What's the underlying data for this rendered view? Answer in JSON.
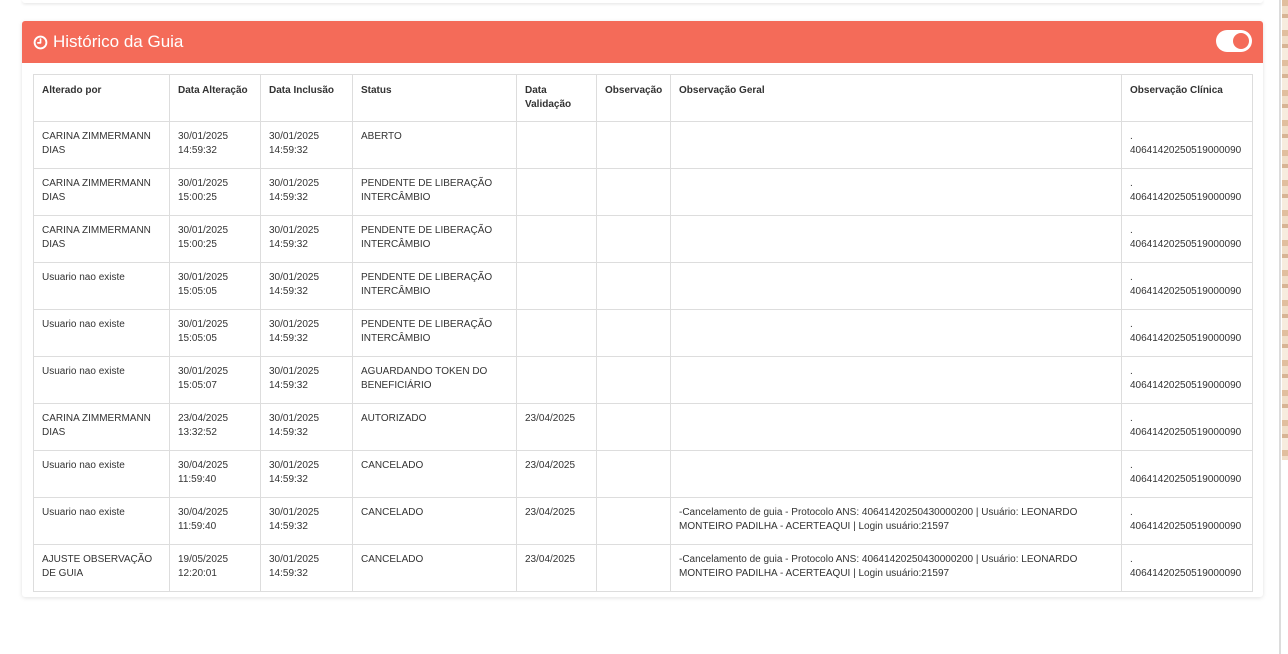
{
  "panel": {
    "title": "Histórico da Guia",
    "accent_color": "#f46b59",
    "title_icon": "clock-icon",
    "toggle_state": "on"
  },
  "table": {
    "headers": {
      "alterado_por": "Alterado por",
      "data_alteracao": "Data Alteração",
      "data_inclusao": "Data Inclusão",
      "status": "Status",
      "data_validacao": "Data Validação",
      "observacao": "Observação",
      "observacao_geral": "Observação Geral",
      "observacao_clinica": "Observação Clínica"
    },
    "rows": [
      {
        "alterado_por": "CARINA ZIMMERMANN DIAS",
        "data_alteracao": "30/01/2025 14:59:32",
        "data_inclusao": "30/01/2025 14:59:32",
        "status": "ABERTO",
        "data_validacao": "",
        "observacao": "",
        "observacao_geral": "",
        "observacao_clinica": ". 40641420250519000090"
      },
      {
        "alterado_por": "CARINA ZIMMERMANN DIAS",
        "data_alteracao": "30/01/2025 15:00:25",
        "data_inclusao": "30/01/2025 14:59:32",
        "status": "PENDENTE DE LIBERAÇÃO INTERCÂMBIO",
        "data_validacao": "",
        "observacao": "",
        "observacao_geral": "",
        "observacao_clinica": ". 40641420250519000090"
      },
      {
        "alterado_por": "CARINA ZIMMERMANN DIAS",
        "data_alteracao": "30/01/2025 15:00:25",
        "data_inclusao": "30/01/2025 14:59:32",
        "status": "PENDENTE DE LIBERAÇÃO INTERCÂMBIO",
        "data_validacao": "",
        "observacao": "",
        "observacao_geral": "",
        "observacao_clinica": ". 40641420250519000090"
      },
      {
        "alterado_por": "Usuario nao existe",
        "data_alteracao": "30/01/2025 15:05:05",
        "data_inclusao": "30/01/2025 14:59:32",
        "status": "PENDENTE DE LIBERAÇÃO INTERCÂMBIO",
        "data_validacao": "",
        "observacao": "",
        "observacao_geral": "",
        "observacao_clinica": ". 40641420250519000090"
      },
      {
        "alterado_por": "Usuario nao existe",
        "data_alteracao": "30/01/2025 15:05:05",
        "data_inclusao": "30/01/2025 14:59:32",
        "status": "PENDENTE DE LIBERAÇÃO INTERCÂMBIO",
        "data_validacao": "",
        "observacao": "",
        "observacao_geral": "",
        "observacao_clinica": ". 40641420250519000090"
      },
      {
        "alterado_por": "Usuario nao existe",
        "data_alteracao": "30/01/2025 15:05:07",
        "data_inclusao": "30/01/2025 14:59:32",
        "status": "AGUARDANDO TOKEN DO BENEFICIÁRIO",
        "data_validacao": "",
        "observacao": "",
        "observacao_geral": "",
        "observacao_clinica": ". 40641420250519000090"
      },
      {
        "alterado_por": "CARINA ZIMMERMANN DIAS",
        "data_alteracao": "23/04/2025 13:32:52",
        "data_inclusao": "30/01/2025 14:59:32",
        "status": "AUTORIZADO",
        "data_validacao": "23/04/2025",
        "observacao": "",
        "observacao_geral": "",
        "observacao_clinica": ". 40641420250519000090"
      },
      {
        "alterado_por": "Usuario nao existe",
        "data_alteracao": "30/04/2025 11:59:40",
        "data_inclusao": "30/01/2025 14:59:32",
        "status": "CANCELADO",
        "data_validacao": "23/04/2025",
        "observacao": "",
        "observacao_geral": "",
        "observacao_clinica": ". 40641420250519000090"
      },
      {
        "alterado_por": "Usuario nao existe",
        "data_alteracao": "30/04/2025 11:59:40",
        "data_inclusao": "30/01/2025 14:59:32",
        "status": "CANCELADO",
        "data_validacao": "23/04/2025",
        "observacao": "",
        "observacao_geral": "-Cancelamento de guia - Protocolo ANS: 40641420250430000200 | Usuário: LEONARDO MONTEIRO PADILHA - ACERTEAQUI | Login usuário:21597",
        "observacao_clinica": ". 40641420250519000090"
      },
      {
        "alterado_por": "AJUSTE OBSERVAÇÃO DE GUIA",
        "data_alteracao": "19/05/2025 12:20:01",
        "data_inclusao": "30/01/2025 14:59:32",
        "status": "CANCELADO",
        "data_validacao": "23/04/2025",
        "observacao": "",
        "observacao_geral": "-Cancelamento de guia - Protocolo ANS: 40641420250430000200 | Usuário: LEONARDO MONTEIRO PADILHA - ACERTEAQUI | Login usuário:21597",
        "observacao_clinica": ". 40641420250519000090"
      }
    ]
  }
}
